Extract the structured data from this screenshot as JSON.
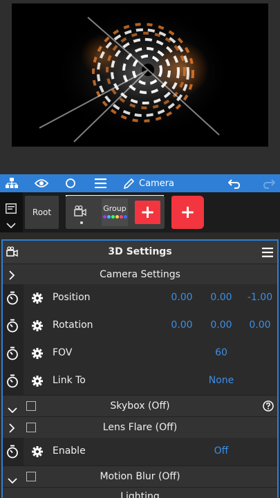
{
  "toolbar": {
    "icons": [
      "hierarchy-icon",
      "eye-icon",
      "circle-icon",
      "menu-icon",
      "pencil-icon",
      "undo-icon",
      "redo-icon"
    ],
    "active_label": "Camera",
    "accent": "#2f7fd6"
  },
  "layers": {
    "root_label": "Root",
    "group_label": "Group",
    "add_color": "#f2353e"
  },
  "panel": {
    "title": "3D Settings",
    "camera_section": "Camera Settings",
    "position": {
      "label": "Position",
      "x": "0.00",
      "y": "0.00",
      "z": "-1.00"
    },
    "rotation": {
      "label": "Rotation",
      "x": "0.00",
      "y": "0.00",
      "z": "0.00"
    },
    "fov": {
      "label": "FOV",
      "value": "60"
    },
    "link_to": {
      "label": "Link To",
      "value": "None"
    },
    "skybox": "Skybox (Off)",
    "lens_flare": "Lens Flare (Off)",
    "enable": {
      "label": "Enable",
      "value": "Off"
    },
    "motion_blur": "Motion Blur (Off)",
    "lighting": "Lighting",
    "value_color": "#3d8fe6"
  }
}
